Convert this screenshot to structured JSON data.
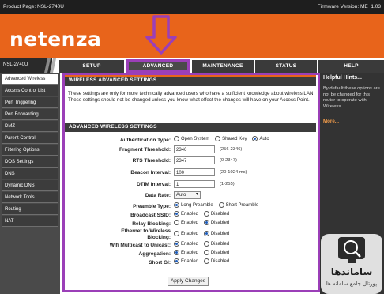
{
  "topbar": {
    "product_page": "Product Page: NSL-2740U",
    "firmware": "Firmware Version: ME_1.03"
  },
  "brand": {
    "logo": "netenza"
  },
  "nav": {
    "model": "NSL-2740U",
    "tabs": [
      {
        "label": "SETUP"
      },
      {
        "label": "ADVANCED"
      },
      {
        "label": "MAINTENANCE"
      },
      {
        "label": "STATUS"
      },
      {
        "label": "HELP"
      }
    ]
  },
  "sidebar": {
    "items": [
      {
        "label": "Advanced Wireless"
      },
      {
        "label": "Access Control List"
      },
      {
        "label": "Port Triggering"
      },
      {
        "label": "Port Forwarding"
      },
      {
        "label": "DMZ"
      },
      {
        "label": "Parent Control"
      },
      {
        "label": "Filtering Options"
      },
      {
        "label": "DOS Settings"
      },
      {
        "label": "DNS"
      },
      {
        "label": "Dynamic DNS"
      },
      {
        "label": "Network Tools"
      },
      {
        "label": "Routing"
      },
      {
        "label": "NAT"
      }
    ]
  },
  "main": {
    "section1_title": "WIRELESS ADVANCED SETTINGS",
    "intro": "These settings are only for more technically advanced users who have a sufficient knowledge about wireless LAN. These settings should not be changed unless you know what effect the changes will have on your Access Point.",
    "section2_title": "ADVANCED WIRELESS SETTINGS",
    "auth": {
      "label": "Authentication Type:",
      "options": [
        "Open System",
        "Shared Key",
        "Auto"
      ]
    },
    "fragment": {
      "label": "Fragment Threshold:",
      "value": "2346",
      "hint": "(256-2346)"
    },
    "rts": {
      "label": "RTS Threshold:",
      "value": "2347",
      "hint": "(0-2347)"
    },
    "beacon": {
      "label": "Beacon Interval:",
      "value": "100",
      "hint": "(20-1024 ms)"
    },
    "dtim": {
      "label": "DTIM Interval:",
      "value": "1",
      "hint": "(1-255)"
    },
    "datarate": {
      "label": "Data Rate:",
      "value": "Auto"
    },
    "preamble": {
      "label": "Preamble Type:",
      "options": [
        "Long Preamble",
        "Short Preamble"
      ]
    },
    "broadcast": {
      "label": "Broadcast SSID:",
      "on": "Enabled",
      "off": "Disabled"
    },
    "relay": {
      "label": "Relay Blocking:",
      "on": "Enabled",
      "off": "Disabled"
    },
    "ethernet": {
      "label1": "Ethernet to Wireless",
      "label2": "Blocking:",
      "on": "Enabled",
      "off": "Disabled"
    },
    "wifimc": {
      "label": "Wifi Multicast to Unicast:",
      "on": "Enabled",
      "off": "Disabled"
    },
    "aggregation": {
      "label": "Aggregation:",
      "on": "Enabled",
      "off": "Disabled"
    },
    "shortgi": {
      "label": "Short GI:",
      "on": "Enabled",
      "off": "Disabled"
    },
    "apply": "Apply Changes"
  },
  "help": {
    "title": "Helpful Hints...",
    "body": "By default these options are not be changed for this router to operate with Wireless.",
    "more": "More..."
  },
  "watermark": {
    "line1": "ساماندها",
    "line2": "پورتال جامع سامانه ها"
  },
  "colors": {
    "orange": "#e8641b",
    "highlight": "#9b3fb8",
    "dark": "#3c3c3c"
  }
}
